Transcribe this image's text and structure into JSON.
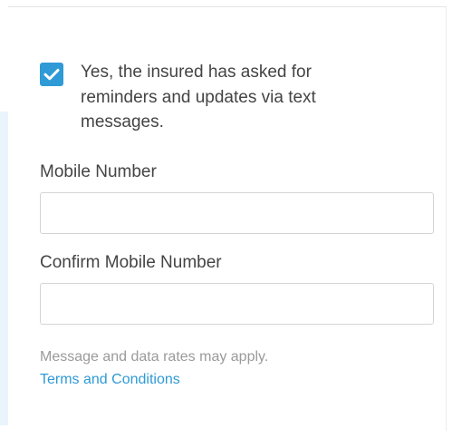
{
  "form": {
    "consent": {
      "checked": true,
      "label": "Yes, the insured has asked for reminders and updates via text messages."
    },
    "mobile_number": {
      "label": "Mobile Number",
      "value": ""
    },
    "confirm_mobile_number": {
      "label": "Confirm Mobile Number",
      "value": ""
    },
    "rates_note": "Message and data rates may apply.",
    "terms_link": "Terms and Conditions"
  },
  "colors": {
    "accent": "#2e9ad6",
    "text": "#444444",
    "muted_text": "#9a9a9a",
    "border": "#d4d4d4",
    "side_accent": "#e9f4fb"
  },
  "icons": {
    "checkbox": "checkmark-icon"
  }
}
